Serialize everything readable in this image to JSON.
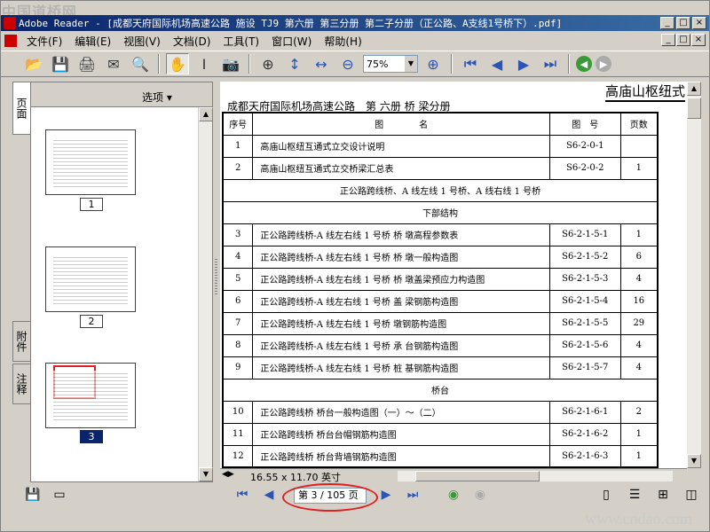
{
  "watermark_top": "中国道桥网",
  "watermark_bottom": "www.cndao.com",
  "window": {
    "title": "Adobe Reader - [成都天府国际机场高速公路 施设 TJ9 第六册 第三分册 第二子分册（正公路、A支线1号桥下）.pdf]",
    "min": "_",
    "max": "□",
    "close": "×"
  },
  "menu": [
    "文件(F)",
    "编辑(E)",
    "视图(V)",
    "文档(D)",
    "工具(T)",
    "窗口(W)",
    "帮助(H)"
  ],
  "toolbar": {
    "zoom_value": "75%"
  },
  "left_tabs": {
    "pages": "页面",
    "attachments": "附件",
    "comments": "注释"
  },
  "thumbs": {
    "options_label": "选项 ▾",
    "pages": [
      {
        "num": "1",
        "selected": false
      },
      {
        "num": "2",
        "selected": false
      },
      {
        "num": "3",
        "selected": true
      }
    ]
  },
  "document": {
    "heading": "成都天府国际机场高速公路　第 六册 桥 梁分册",
    "corner_title": "高庙山枢纽式",
    "table": {
      "headers": [
        "序号",
        "图　　　　名",
        "图　号",
        "页数"
      ],
      "rows": [
        {
          "type": "row",
          "no": "1",
          "name": "高庙山枢纽互通式立交设计说明",
          "code": "S6-2-0-1",
          "pages": ""
        },
        {
          "type": "row",
          "no": "2",
          "name": "高庙山枢纽互通式立交桥梁汇总表",
          "code": "S6-2-0-2",
          "pages": "1"
        },
        {
          "type": "section",
          "text": "正公路跨线桥、A 线左线 1 号桥、A 线右线 1 号桥"
        },
        {
          "type": "section",
          "text": "下部结构"
        },
        {
          "type": "row",
          "no": "3",
          "name": "正公路跨线桥-A 线左右线 1 号桥 桥 墩高程参数表",
          "code": "S6-2-1-5-1",
          "pages": "1"
        },
        {
          "type": "row",
          "no": "4",
          "name": "正公路跨线桥-A 线左右线 1 号桥 桥 墩一般构造图",
          "code": "S6-2-1-5-2",
          "pages": "6"
        },
        {
          "type": "row",
          "no": "5",
          "name": "正公路跨线桥-A 线左右线 1 号桥 桥 墩盖梁预应力构造图",
          "code": "S6-2-1-5-3",
          "pages": "4"
        },
        {
          "type": "row",
          "no": "6",
          "name": "正公路跨线桥-A 线左右线 1 号桥 盖 梁钢筋构造图",
          "code": "S6-2-1-5-4",
          "pages": "16"
        },
        {
          "type": "row",
          "no": "7",
          "name": "正公路跨线桥-A 线左右线 1 号桥 墩钢筋构造图",
          "code": "S6-2-1-5-5",
          "pages": "29"
        },
        {
          "type": "row",
          "no": "8",
          "name": "正公路跨线桥-A 线左右线 1 号桥 承 台钢筋构造图",
          "code": "S6-2-1-5-6",
          "pages": "4"
        },
        {
          "type": "row",
          "no": "9",
          "name": "正公路跨线桥-A 线左右线 1 号桥 桩 基钢筋构造图",
          "code": "S6-2-1-5-7",
          "pages": "4"
        },
        {
          "type": "section",
          "text": "桥台"
        },
        {
          "type": "row",
          "no": "10",
          "name": "正公路跨线桥 桥台一般构造图（一）～（二）",
          "code": "S6-2-1-6-1",
          "pages": "2"
        },
        {
          "type": "row",
          "no": "11",
          "name": "正公路跨线桥 桥台台帽钢筋构造图",
          "code": "S6-2-1-6-2",
          "pages": "1"
        },
        {
          "type": "row",
          "no": "12",
          "name": "正公路跨线桥 桥台背墙钢筋构造图",
          "code": "S6-2-1-6-3",
          "pages": "1"
        }
      ]
    }
  },
  "status": {
    "page_size": "16.55 x 11.70 英寸",
    "page_indicator": "第 3 / 105 页"
  }
}
